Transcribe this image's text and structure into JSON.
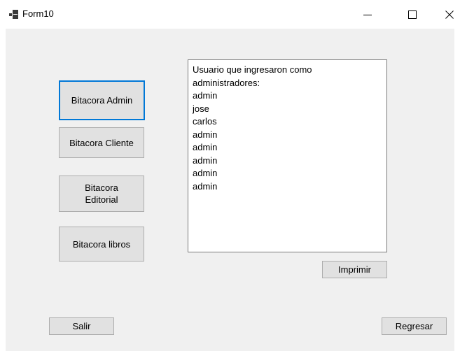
{
  "window": {
    "title": "Form10",
    "icon": "form-icon"
  },
  "buttons": {
    "bitacora_admin": "Bitacora Admin",
    "bitacora_cliente": "Bitacora Cliente",
    "bitacora_editorial": "Bitacora\nEditorial",
    "bitacora_libros": "Bitacora libros",
    "imprimir": "Imprimir",
    "salir": "Salir",
    "regresar": "Regresar"
  },
  "textbox": {
    "lines": [
      "Usuario que ingresaron como",
      "administradores:",
      "admin",
      "jose",
      "carlos",
      "admin",
      "admin",
      "admin",
      "admin",
      "admin"
    ]
  },
  "colors": {
    "focus_border": "#0078d7",
    "client_background": "#f0f0f0",
    "button_face": "#e1e1e1"
  }
}
